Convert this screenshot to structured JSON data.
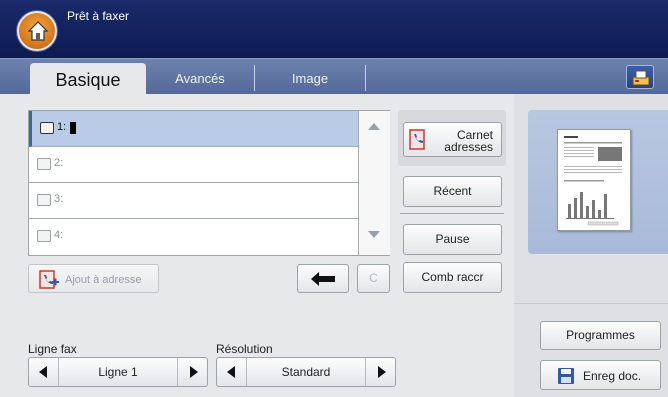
{
  "header": {
    "title": "Prêt à faxer"
  },
  "tabs": [
    {
      "label": "Basique"
    },
    {
      "label": "Avancés"
    },
    {
      "label": "Image"
    }
  ],
  "numbers": [
    {
      "label": "1:"
    },
    {
      "label": "2:"
    },
    {
      "label": "3:"
    },
    {
      "label": "4:"
    }
  ],
  "buttons": {
    "add_address": "Ajout à adresse",
    "clear": "C",
    "address_book_line1": "Carnet",
    "address_book_line2": "adresses",
    "recent": "Récent",
    "pause": "Pause",
    "speed_dial": "Comb raccr",
    "programs": "Programmes",
    "save_doc": "Enreg doc."
  },
  "fax_line": {
    "label": "Ligne fax",
    "value": "Ligne 1"
  },
  "resolution": {
    "label": "Résolution",
    "value": "Standard"
  },
  "icons": {
    "home": "home-icon",
    "fax_settings": "fax-device-icon",
    "phone": "phone-icon",
    "backspace": "backspace-arrow-icon",
    "save": "floppy-disk-icon"
  },
  "colors": {
    "accent": "#1a2a6b",
    "selection": "#b9cbe6",
    "home": "#e88a26"
  }
}
